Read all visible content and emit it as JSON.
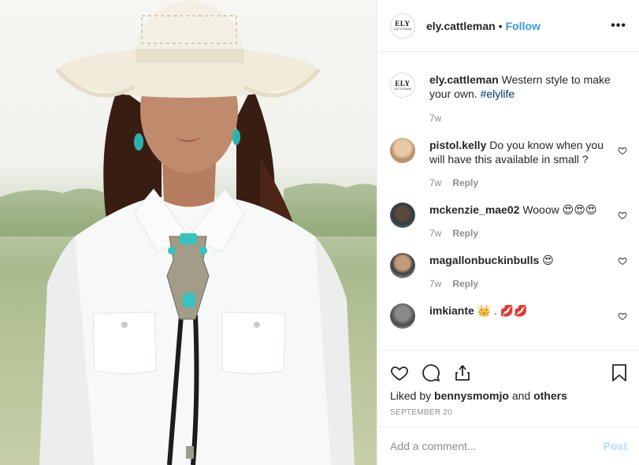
{
  "post": {
    "image_alt": "Woman in white cowboy hat and white western shirt with turquoise bolo tie",
    "header": {
      "avatar_line1": "ELY",
      "avatar_line2": "CATTLEMAN",
      "username": "ely.cattleman",
      "separator": "•",
      "follow_label": "Follow",
      "more_label": "•••"
    },
    "caption": {
      "username": "ely.cattleman",
      "text": "Western style to make your own.",
      "hashtag": "#elylife",
      "time": "7w"
    },
    "comments": [
      {
        "username": "pistol.kelly",
        "text": "Do you know when you will have this available in small ?",
        "time": "7w",
        "reply_label": "Reply"
      },
      {
        "username": "mckenzie_mae02",
        "text": "Wooow 😍😍😍",
        "time": "7w",
        "reply_label": "Reply"
      },
      {
        "username": "magallonbuckinbulls",
        "text": "😍",
        "time": "7w",
        "reply_label": "Reply"
      },
      {
        "username": "imkiante",
        "text": "👑 . 💋💋",
        "time": "",
        "reply_label": ""
      }
    ],
    "likes": {
      "prefix": "Liked by",
      "user": "bennysmomjo",
      "conjunction": "and",
      "others": "others"
    },
    "date": "SEPTEMBER 20",
    "add_comment": {
      "placeholder": "Add a comment...",
      "post_label": "Post"
    },
    "colors": {
      "accent": "#3897f0",
      "post_disabled": "#b2dffc",
      "muted": "#8e8e8e",
      "text": "#262626"
    },
    "icons": [
      "heart-icon",
      "comment-icon",
      "share-icon",
      "bookmark-icon",
      "more-icon"
    ]
  }
}
